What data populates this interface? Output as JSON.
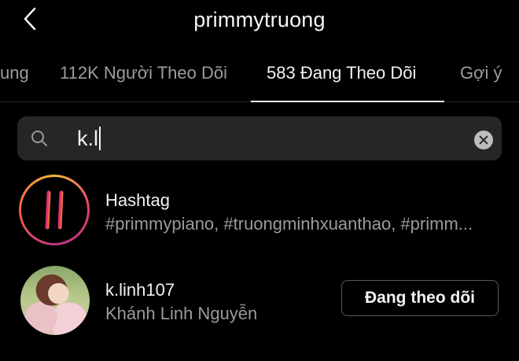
{
  "header": {
    "title": "primmytruong"
  },
  "tabs": [
    {
      "label": "ung"
    },
    {
      "label": "112K Người Theo Dõi"
    },
    {
      "label": "583 Đang Theo Dõi"
    },
    {
      "label": "Gợi ý"
    }
  ],
  "search": {
    "value": "k.l",
    "placeholder": ""
  },
  "results": [
    {
      "type": "hashtag",
      "title": "Hashtag",
      "subtitle": "#primmypiano, #truongminhxuanthao, #primm..."
    },
    {
      "type": "user",
      "username": "k.linh107",
      "full_name": "Khánh Linh Nguyễn",
      "button_label": "Đang theo dõi"
    }
  ],
  "colors": {
    "background": "#000000",
    "search_bg": "#262626",
    "muted_text": "#9a9a9a"
  },
  "icons": {
    "back": "chevron-left-icon",
    "search": "search-icon",
    "clear": "clear-icon",
    "hashtag": "hashtag-icon"
  }
}
